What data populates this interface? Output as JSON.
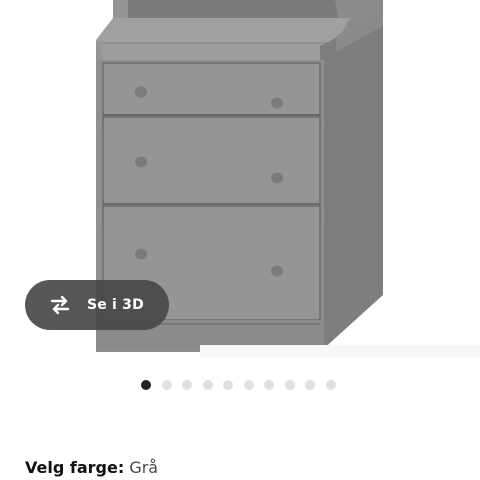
{
  "product_image": {
    "subject": "grey chest of drawers with shelf unit",
    "colors": {
      "body": "#8a8a8a",
      "front": "#929292",
      "shadow": "#6e6e6e",
      "knob": "#7d7d7d"
    }
  },
  "view_3d": {
    "label": "Se i 3D",
    "icon": "rotate-3d-icon"
  },
  "carousel": {
    "dot_count": 10,
    "active_index": 0,
    "active_color": "#222222",
    "inactive_color": "#e0e0e0"
  },
  "color_selector": {
    "label": "Velg farge:",
    "value": "Grå"
  }
}
